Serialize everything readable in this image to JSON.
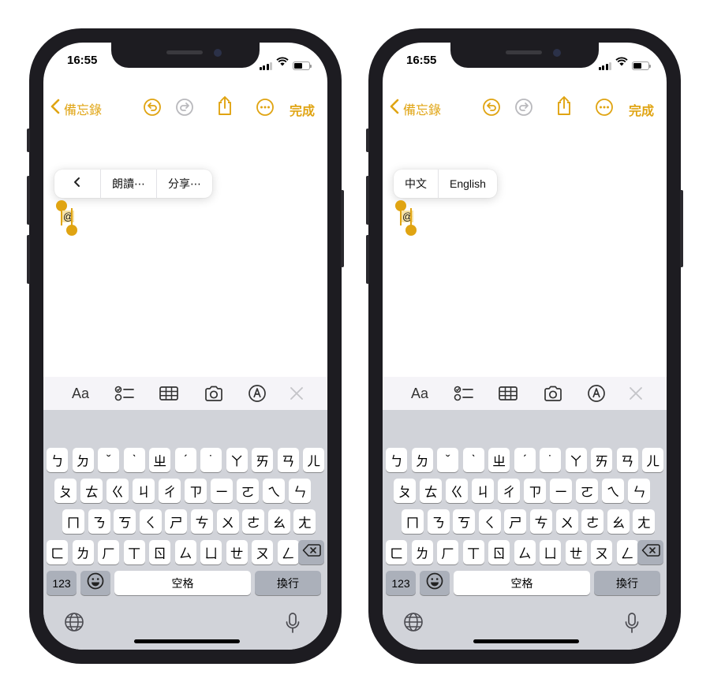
{
  "accent_color": "#e0a412",
  "status": {
    "time": "16:55",
    "battery_level": 0.55
  },
  "nav": {
    "back_label": "備忘錄",
    "done_label": "完成",
    "icons": [
      "chevron-left-icon",
      "undo-icon",
      "redo-icon",
      "share-icon",
      "more-icon"
    ]
  },
  "note_text": "@",
  "popups": {
    "left": [
      "朗讀⋯",
      "分享⋯"
    ],
    "right": [
      "中文",
      "English"
    ]
  },
  "toolbar_icons": [
    "text-format-icon",
    "checklist-icon",
    "table-icon",
    "camera-icon",
    "markup-icon",
    "close-icon"
  ],
  "toolbar_labels": {
    "format": "Aa"
  },
  "keyboard": {
    "row1": [
      "ㄅ",
      "ㄉ",
      "ˇ",
      "ˋ",
      "ㄓ",
      "ˊ",
      "˙",
      "ㄚ",
      "ㄞ",
      "ㄢ",
      "ㄦ"
    ],
    "row2": [
      "ㄆ",
      "ㄊ",
      "ㄍ",
      "ㄐ",
      "ㄔ",
      "ㄗ",
      "ㄧ",
      "ㄛ",
      "ㄟ",
      "ㄣ"
    ],
    "row3": [
      "ㄇ",
      "ㄋ",
      "ㄎ",
      "ㄑ",
      "ㄕ",
      "ㄘ",
      "ㄨ",
      "ㄜ",
      "ㄠ",
      "ㄤ"
    ],
    "row4": [
      "ㄈ",
      "ㄌ",
      "ㄏ",
      "ㄒ",
      "ㄖ",
      "ㄙ",
      "ㄩ",
      "ㄝ",
      "ㄡ",
      "ㄥ"
    ],
    "numbers_label": "123",
    "space_label": "空格",
    "return_label": "換行"
  }
}
